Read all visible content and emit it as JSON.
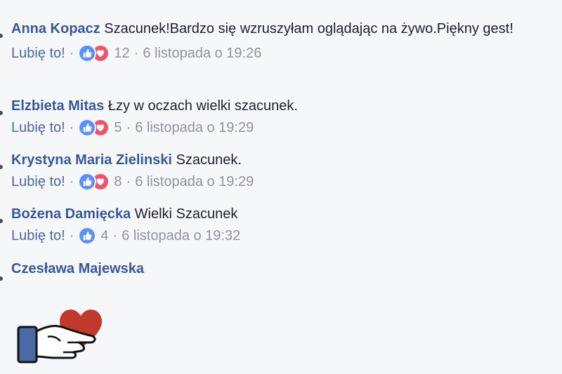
{
  "like_label": "Lubię to!",
  "separator": "·",
  "comments": [
    {
      "author": "Anna Kopacz",
      "text": "Szacunek!Bardzo się wzruszyłam oglądając na żywo.Piękny gest!",
      "reactions": [
        "like-icon",
        "love-icon"
      ],
      "count": "12",
      "time": "6 listopada o 19:26"
    },
    {
      "author": "Elzbieta Mitas",
      "text": "Łzy w oczach wielki szacunek.",
      "reactions": [
        "like-icon",
        "love-icon"
      ],
      "count": "5",
      "time": "6 listopada o 19:29"
    },
    {
      "author": "Krystyna Maria Zielinski",
      "text": "Szacunek.",
      "reactions": [
        "like-icon",
        "love-icon"
      ],
      "count": "8",
      "time": "6 listopada o 19:29"
    },
    {
      "author": "Bożena Damięcka",
      "text": "Wielki Szacunek",
      "reactions": [
        "like-icon"
      ],
      "count": "4",
      "time": "6 listopada o 19:32"
    },
    {
      "author": "Czesława Majewska",
      "sticker": "hand-holding-heart-sticker"
    }
  ],
  "colors": {
    "author": "#365899",
    "meta": "#90949c",
    "like_reaction": "#5890ff",
    "love_reaction": "#f25268",
    "background": "#f6f7f9"
  }
}
